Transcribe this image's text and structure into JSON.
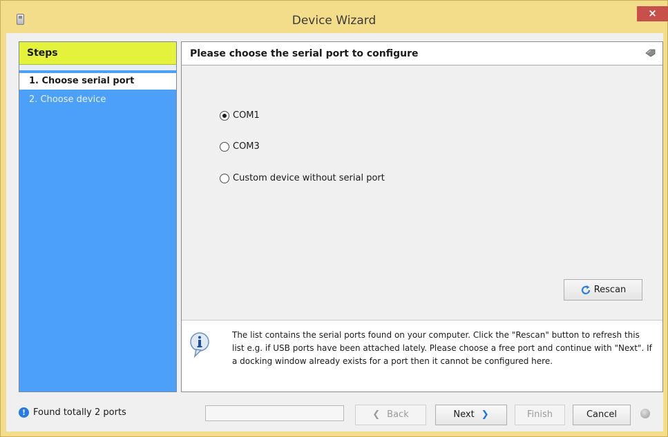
{
  "window": {
    "title": "Device Wizard",
    "close_glyph": "×",
    "app_icon": "device-icon"
  },
  "steps": {
    "header": "Steps",
    "items": [
      {
        "label": "1. Choose serial port",
        "active": true
      },
      {
        "label": "2. Choose device",
        "active": false
      }
    ]
  },
  "content": {
    "header": "Please choose the serial port to configure",
    "header_icon": "tag-icon",
    "ports": [
      {
        "label": "COM1",
        "selected": true
      },
      {
        "label": "COM3",
        "selected": false
      },
      {
        "label": "Custom device without serial port",
        "selected": false
      }
    ],
    "rescan_label": "Rescan",
    "info_icon": "info-bubble-icon",
    "info_text": "The list contains the serial ports found on your computer. Click the \"Rescan\" button to refresh this list e.g. if USB ports have been attached lately. Please choose a free port and continue with \"Next\". If a docking window already exists for a port then it cannot be configured here."
  },
  "footer": {
    "status_text": "Found totally 2 ports",
    "status_icon_glyph": "!",
    "progress_fraction": 0.0,
    "back_label": "Back",
    "next_label": "Next",
    "finish_label": "Finish",
    "cancel_label": "Cancel",
    "back_arrow": "❮",
    "next_arrow": "❯"
  },
  "colors": {
    "title_bar": "#f3dc8a",
    "steps_bg": "#4ca0f7",
    "steps_header": "#e4f23b",
    "close_button": "#c7504a",
    "accent": "#1e73d6"
  }
}
